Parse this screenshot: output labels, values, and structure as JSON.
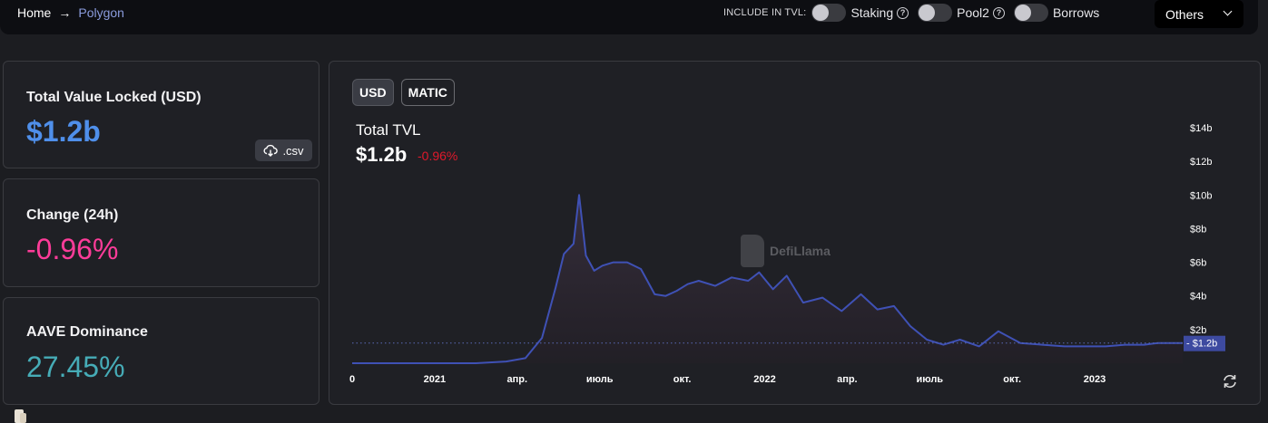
{
  "breadcrumb": {
    "home": "Home",
    "current": "Polygon"
  },
  "tvl_options": {
    "include_label": "INCLUDE IN TVL:",
    "toggles": [
      {
        "label": "Staking",
        "on": false
      },
      {
        "label": "Pool2",
        "on": false
      },
      {
        "label": "Borrows",
        "on": false
      }
    ],
    "others_label": "Others"
  },
  "stats": {
    "tvl": {
      "title": "Total Value Locked (USD)",
      "value": "$1.2b",
      "csv_label": ".csv"
    },
    "change": {
      "title": "Change (24h)",
      "value": "-0.96%"
    },
    "dominance": {
      "title": "AAVE Dominance",
      "value": "27.45%"
    }
  },
  "colors": {
    "tvl_value": "#4f8fea",
    "change_value": "#fd3c99",
    "dominance_value": "#46acb7",
    "line": "#3f51b5",
    "negative": "#e0192b"
  },
  "chart_panel": {
    "denominations": [
      "USD",
      "MATIC"
    ],
    "active_denomination": "USD",
    "title": "Total TVL",
    "value": "$1.2b",
    "change": "-0.96%",
    "watermark": "DefiLlama",
    "current_marker": "$1.2b"
  },
  "chart_data": {
    "type": "area",
    "ylim": [
      0,
      14
    ],
    "ytick_values": [
      2,
      4,
      6,
      8,
      10,
      12,
      14
    ],
    "ytick_labels": [
      "$2b",
      "$4b",
      "$6b",
      "$8b",
      "$10b",
      "$12b",
      "$14b"
    ],
    "xtick_labels": [
      "0",
      "2021",
      "апр.",
      "июль",
      "окт.",
      "2022",
      "апр.",
      "июль",
      "окт.",
      "2023"
    ],
    "xlim": [
      0,
      30.2
    ],
    "x": [
      0,
      3,
      4.5,
      5.6,
      6.3,
      6.9,
      7.4,
      7.7,
      8.05,
      8.25,
      8.5,
      8.8,
      9.1,
      9.5,
      10,
      10.5,
      11,
      11.4,
      11.8,
      12.2,
      12.6,
      13.2,
      13.8,
      14.4,
      14.8,
      15.3,
      15.8,
      16.4,
      17.1,
      17.8,
      18.5,
      19.1,
      19.7,
      20.3,
      20.9,
      21.5,
      22.1,
      22.8,
      23.5,
      24.3,
      25.1,
      25.9,
      26.7,
      27.4,
      28.1,
      28.8,
      29.3,
      30.2
    ],
    "y": [
      0,
      0,
      0,
      0.1,
      0.3,
      1.5,
      4.5,
      6.5,
      7.1,
      10.0,
      6.4,
      5.5,
      5.8,
      6.0,
      6.0,
      5.6,
      4.1,
      4.0,
      4.3,
      4.7,
      4.9,
      4.6,
      5.1,
      4.9,
      5.4,
      4.4,
      5.2,
      3.6,
      3.9,
      3.1,
      4.1,
      3.2,
      3.4,
      2.2,
      1.4,
      1.1,
      1.4,
      1.0,
      1.9,
      1.2,
      1.1,
      1.0,
      1.0,
      1.0,
      1.1,
      1.1,
      1.2,
      1.2
    ]
  }
}
